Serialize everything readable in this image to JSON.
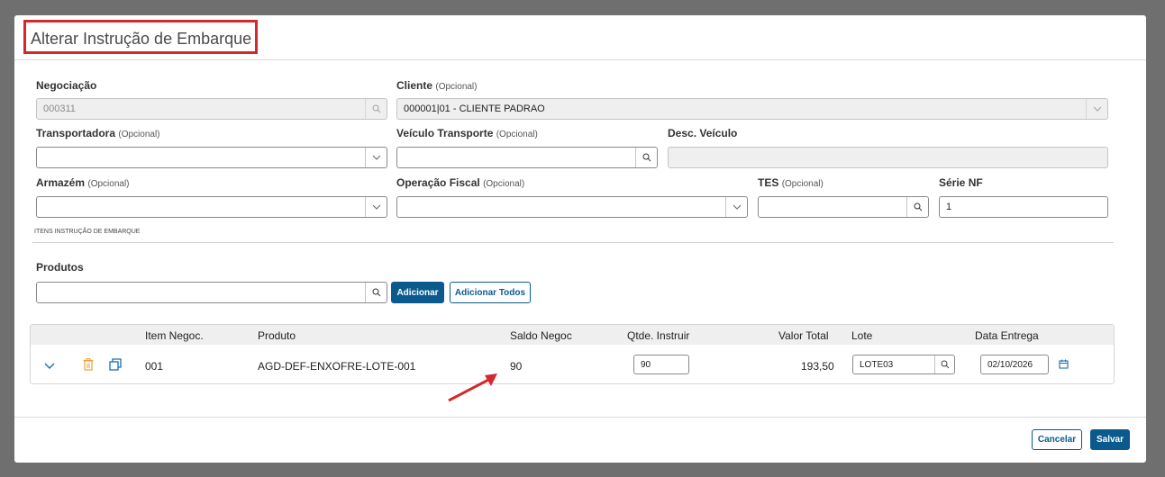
{
  "modal": {
    "title": "Alterar Instrução de Embarque"
  },
  "form": {
    "negociacao": {
      "label": "Negociação",
      "value": "000311"
    },
    "cliente": {
      "label": "Cliente",
      "optional": "(Opcional)",
      "value": "000001|01 - CLIENTE PADRAO"
    },
    "transportadora": {
      "label": "Transportadora",
      "optional": "(Opcional)",
      "value": ""
    },
    "veiculo": {
      "label": "Veículo Transporte",
      "optional": "(Opcional)",
      "value": ""
    },
    "desc_veiculo": {
      "label": "Desc. Veículo",
      "value": ""
    },
    "armazem": {
      "label": "Armazém",
      "optional": "(Opcional)",
      "value": ""
    },
    "operacao_fiscal": {
      "label": "Operação Fiscal",
      "optional": "(Opcional)",
      "value": ""
    },
    "tes": {
      "label": "TES",
      "optional": "(Opcional)",
      "value": ""
    },
    "serie_nf": {
      "label": "Série NF",
      "value": "1"
    }
  },
  "section": {
    "label": "ITENS INSTRUÇÃO DE EMBARQUE"
  },
  "produtos": {
    "label": "Produtos",
    "value": "",
    "add_label": "Adicionar",
    "add_all_label": "Adicionar Todos"
  },
  "table": {
    "headers": {
      "item_negoc": "Item Negoc.",
      "produto": "Produto",
      "saldo_negoc": "Saldo Negoc",
      "qtde_instruir": "Qtde. Instruir",
      "valor_total": "Valor Total",
      "lote": "Lote",
      "data_entrega": "Data Entrega"
    },
    "rows": [
      {
        "item_negoc": "001",
        "produto": "AGD-DEF-ENXOFRE-LOTE-001",
        "saldo_negoc": "90",
        "qtde_instruir": "90",
        "valor_total": "193,50",
        "lote": "LOTE03",
        "data_entrega": "02/10/2026"
      }
    ]
  },
  "footer": {
    "cancel_label": "Cancelar",
    "save_label": "Salvar"
  },
  "colors": {
    "primary": "#0a5a8e",
    "highlight": "#d4282f",
    "delete": "#e8a33a",
    "copy": "#1a6fb0"
  }
}
